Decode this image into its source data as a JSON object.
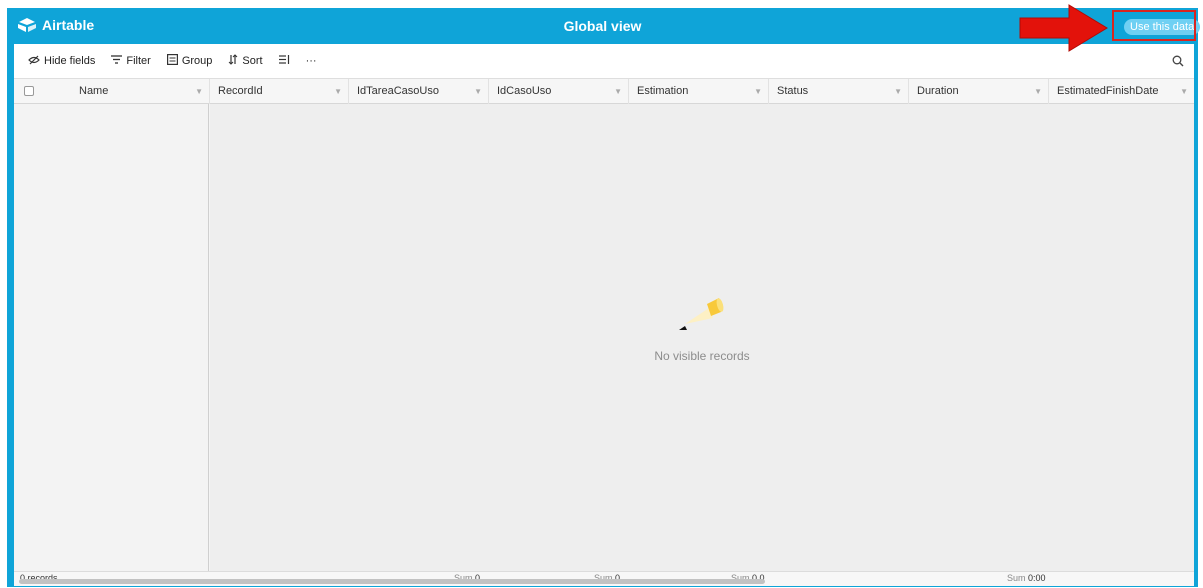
{
  "app": {
    "brand": "Airtable",
    "view_title": "Global view",
    "use_data_label": "Use this data"
  },
  "toolbar": {
    "hide_fields": "Hide fields",
    "filter": "Filter",
    "group": "Group",
    "sort": "Sort",
    "more": "···"
  },
  "table": {
    "columns": [
      "Name",
      "RecordId",
      "IdTareaCasoUso",
      "IdCasoUso",
      "Estimation",
      "Status",
      "Duration",
      "EstimatedFinishDate"
    ],
    "empty_message": "No visible records"
  },
  "footer": {
    "records": "0 records",
    "sum_label": "Sum",
    "sum_values": [
      "0",
      "0",
      "0.0",
      "0:00"
    ]
  },
  "colors": {
    "accent": "#0fa4d8",
    "highlight": "#d9251f",
    "arrow": "#e3120b"
  },
  "icons": [
    "airtable-logo-icon",
    "hide-fields-icon",
    "filter-icon",
    "group-icon",
    "sort-icon",
    "row-height-icon",
    "more-icon",
    "search-icon",
    "flashlight-icon",
    "arrow-icon"
  ]
}
